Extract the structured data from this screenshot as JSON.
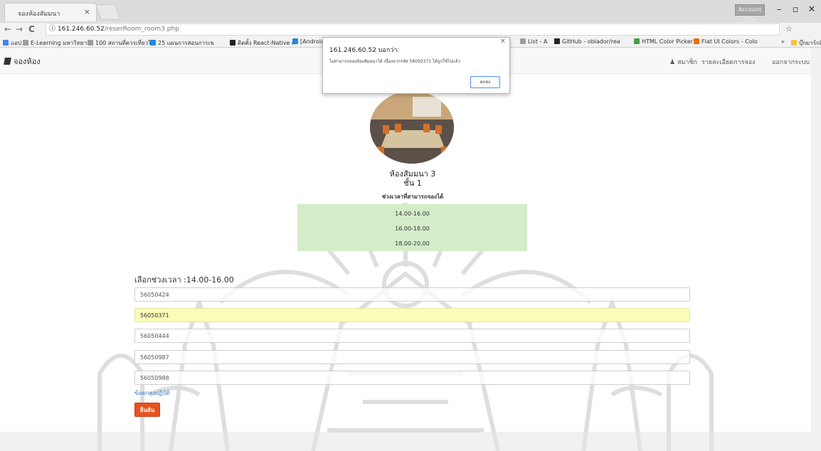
{
  "browser": {
    "tab_title": "จองห้องสัมมนา",
    "tab_close": "×",
    "user_badge": "Account Ctrl",
    "win_min": "–",
    "win_max": "▫",
    "win_close": "✕",
    "nav_back": "←",
    "nav_forward": "→",
    "nav_reload": "C",
    "info_icon": "ⓘ",
    "url_host": "161.246.60.52",
    "url_path": "/reserRoom_room3.php",
    "star": "☆",
    "bookmarks": [
      {
        "label": "แอป",
        "color": "#4285f4"
      },
      {
        "label": "E-Learning มหาวิทยาล",
        "color": "#9e9e9e"
      },
      {
        "label": "100 สถานที่ควรเที่ยวไป",
        "color": "#9e9e9e"
      },
      {
        "label": "25 แผนการสอนการเข",
        "color": "#1e88e5"
      },
      {
        "label": "ติดตั้ง React-Native ค",
        "color": "#222222"
      },
      {
        "label": "[Android",
        "color": "#1e88e5"
      },
      {
        "label": "List - A",
        "color": "#9e9e9e"
      },
      {
        "label": "GitHub - oblador/rea",
        "color": "#222222"
      },
      {
        "label": "HTML Color Picker",
        "color": "#43a047"
      },
      {
        "label": "Flat UI Colors - Colo",
        "color": "#ef6c00"
      },
      {
        "label": "»",
        "color": ""
      },
      {
        "label": "บุ๊กมาร์กอื่นๆ",
        "color": "#f5c242"
      }
    ]
  },
  "navbar": {
    "brand": "จองห้อง",
    "links": [
      "สมาชิก",
      "รายละเอียดการจอง",
      "ออกจากระบบ"
    ]
  },
  "room": {
    "name": "ห้องสัมมนา 3",
    "floor": "ชั้น 1",
    "slots_title": "ช่วงเวลาที่สามารถจองได้",
    "slots": [
      "14.00-16.00",
      "16.00-18.00",
      "18.00-20.00"
    ]
  },
  "form": {
    "selected_label": "เลือกช่วงเวลา :14.00-16.00",
    "student_ids": [
      "56050424",
      "56050371",
      "56050444",
      "56050987",
      "56050988"
    ],
    "highlighted_index": 1,
    "terms_link": "ข้อตกลงปฏิบัติ",
    "submit": "ยืนยัน"
  },
  "dialog": {
    "title": "161.246.60.52 บอกว่า:",
    "message": "ไม่สามารถจองห้องสัมมนาได้ เนื่องจากรหัส 56050371 ได้ถูกใช้ไปแล้ว",
    "ok": "ตกลง",
    "close": "×"
  },
  "colors": {
    "highlight": "#fafcb8",
    "slots_bg": "#d4ecc8",
    "submit_bg": "#e8531d",
    "link": "#3d7cc9"
  }
}
